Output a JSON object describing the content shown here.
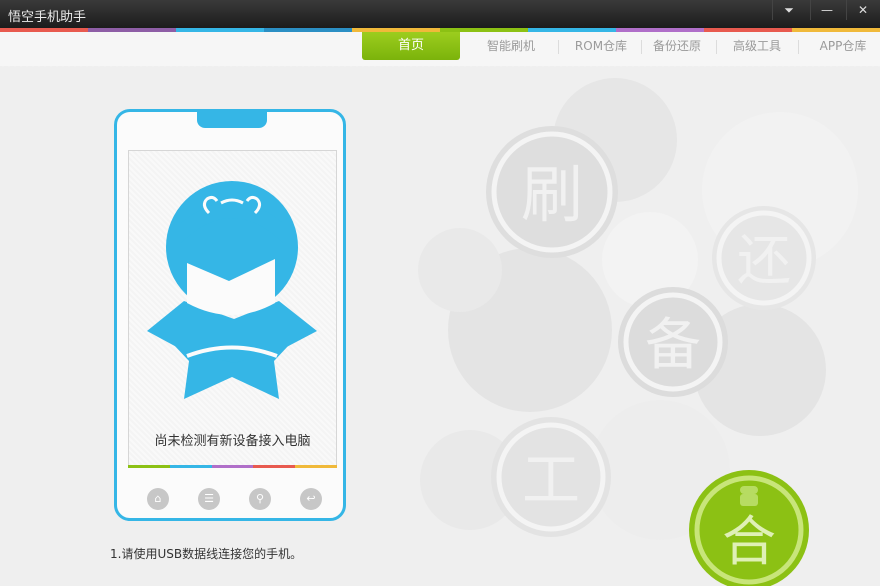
{
  "window": {
    "title": "悟空手机助手",
    "controls": {
      "menu": "⏷",
      "minimize": "—",
      "close": "✕"
    }
  },
  "colors": {
    "accent": "#35b6e6",
    "tab_active": "#8cc114",
    "stripe": [
      "#e85a4f",
      "#8e5ea6",
      "#35b6e6",
      "#2b8fc4",
      "#f0b93a",
      "#8cc114",
      "#35b6e6",
      "#b06fc9",
      "#e85a4f",
      "#f0b93a"
    ]
  },
  "nav": {
    "tabs": [
      {
        "label": "首页",
        "active": true
      },
      {
        "label": "智能刷机",
        "active": false
      },
      {
        "label": "ROM仓库",
        "active": false
      },
      {
        "label": "备份还原",
        "active": false
      },
      {
        "label": "高级工具",
        "active": false
      },
      {
        "label": "APP仓库",
        "active": false
      }
    ]
  },
  "device": {
    "status": "尚未检测有新设备接入电脑",
    "buttons": [
      "home-icon",
      "menu-icon",
      "search-icon",
      "back-icon"
    ]
  },
  "instructions": {
    "step1": "1.请使用USB数据线连接您的手机。"
  },
  "decor": {
    "chars": [
      "刷",
      "还",
      "备",
      "工",
      "合"
    ]
  }
}
